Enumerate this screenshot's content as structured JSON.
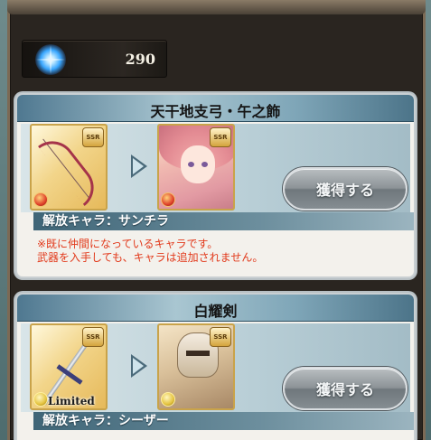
{
  "currency": {
    "icon": "crystal-icon",
    "amount": "290"
  },
  "cards": [
    {
      "title": "天干地支弓・午之飾",
      "weapon": {
        "icon": "bow-icon",
        "rarity": "SSR",
        "element": "fire",
        "badge": ""
      },
      "character": {
        "icon": "character-portrait-icon",
        "rarity": "SSR",
        "element": "fire"
      },
      "button_label": "獲得する",
      "release_label": "解放キャラ：サンチラ",
      "notes": [
        "※既に仲間になっているキャラです。",
        "武器を入手しても、キャラは追加されません。"
      ]
    },
    {
      "title": "白耀剣",
      "weapon": {
        "icon": "sword-icon",
        "rarity": "SSR",
        "element": "light",
        "badge": "Limited"
      },
      "character": {
        "icon": "armored-character-portrait-icon",
        "rarity": "SSR",
        "element": "light"
      },
      "button_label": "獲得する",
      "release_label": "解放キャラ：シーザー",
      "notes": []
    }
  ],
  "colors": {
    "note_red": "#e23a1c",
    "button_gray": "#8c9397",
    "header_blue": "#4f7890"
  }
}
